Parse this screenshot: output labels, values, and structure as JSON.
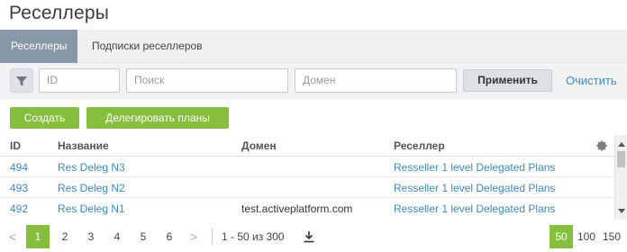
{
  "page": {
    "title": "Реселлеры"
  },
  "tabs": [
    {
      "label": "Реселлеры",
      "active": true
    },
    {
      "label": "Подписки реселлеров",
      "active": false
    }
  ],
  "filters": {
    "id_placeholder": "ID",
    "search_placeholder": "Поиск",
    "domain_placeholder": "Домен",
    "apply_label": "Применить",
    "clear_label": "Очистить"
  },
  "actions": {
    "create_label": "Создать",
    "delegate_label": "Делегировать планы"
  },
  "table": {
    "columns": [
      "ID",
      "Название",
      "Домен",
      "Реселлер"
    ],
    "rows": [
      {
        "id": "494",
        "name": "Res Deleg N3",
        "domain": "",
        "reseller": "Resseller 1 level Delegated Plans"
      },
      {
        "id": "493",
        "name": "Res Deleg N2",
        "domain": "",
        "reseller": "Resseller 1 level Delegated Plans"
      },
      {
        "id": "492",
        "name": "Res Deleg N1",
        "domain": "test.activeplatform.com",
        "reseller": "Resseller 1 level Delegated Plans"
      }
    ]
  },
  "pagination": {
    "prev": "<",
    "next": ">",
    "pages": [
      "1",
      "2",
      "3",
      "4",
      "5",
      "6"
    ],
    "current_page": "1",
    "range_text": "1 - 50 из 300",
    "page_sizes": [
      "50",
      "100",
      "150"
    ],
    "current_page_size": "50"
  },
  "colors": {
    "accent_green": "#86be3e",
    "link_blue": "#3d8ac4",
    "active_tab": "#8898a8"
  },
  "icons": [
    "filter-icon",
    "settings-gear-icon",
    "download-icon",
    "chevron-left-icon",
    "chevron-right-icon"
  ]
}
